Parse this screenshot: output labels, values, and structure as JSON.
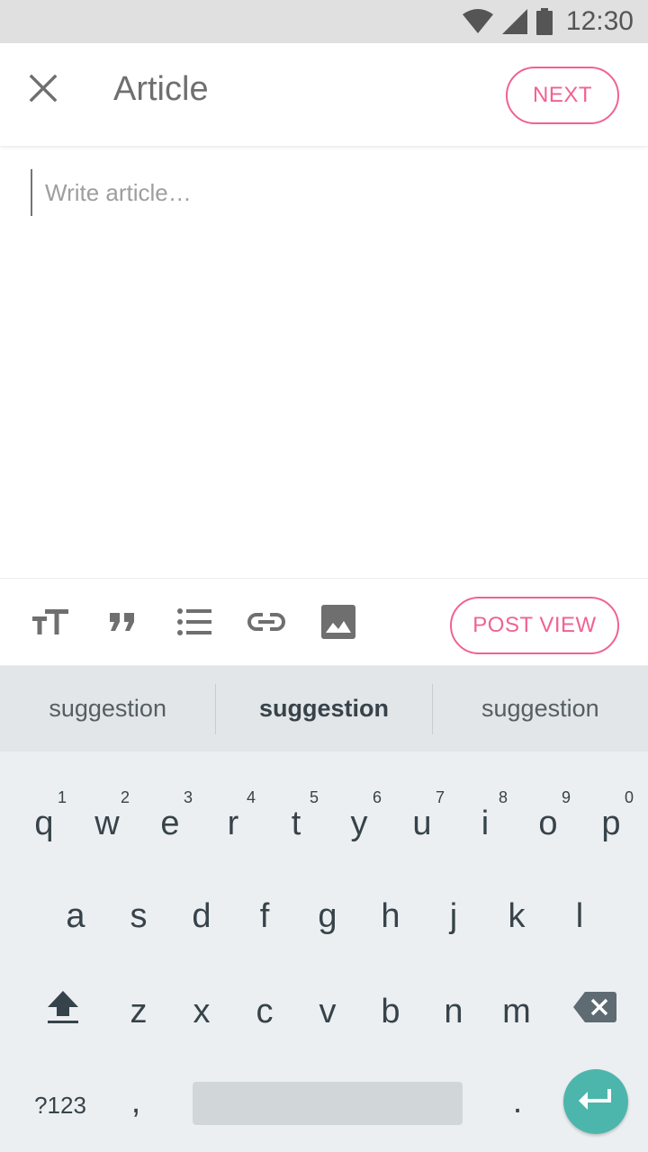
{
  "status_bar": {
    "time": "12:30",
    "icons": [
      "wifi-icon",
      "cell-signal-icon",
      "battery-icon"
    ]
  },
  "app_bar": {
    "close_icon": "close-icon",
    "title": "Article",
    "next_label": "NEXT"
  },
  "editor": {
    "placeholder": "Write article…",
    "value": ""
  },
  "format_toolbar": {
    "tools": [
      "text-size-icon",
      "quote-icon",
      "list-icon",
      "link-icon",
      "image-icon"
    ],
    "post_view_label": "POST VIEW"
  },
  "keyboard": {
    "suggestions": [
      "suggestion",
      "suggestion",
      "suggestion"
    ],
    "row1": [
      {
        "key": "q",
        "hint": "1"
      },
      {
        "key": "w",
        "hint": "2"
      },
      {
        "key": "e",
        "hint": "3"
      },
      {
        "key": "r",
        "hint": "4"
      },
      {
        "key": "t",
        "hint": "5"
      },
      {
        "key": "y",
        "hint": "6"
      },
      {
        "key": "u",
        "hint": "7"
      },
      {
        "key": "i",
        "hint": "8"
      },
      {
        "key": "o",
        "hint": "9"
      },
      {
        "key": "p",
        "hint": "0"
      }
    ],
    "row2": [
      "a",
      "s",
      "d",
      "f",
      "g",
      "h",
      "j",
      "k",
      "l"
    ],
    "row3": [
      "z",
      "x",
      "c",
      "v",
      "b",
      "n",
      "m"
    ],
    "symbols_label": "?123",
    "comma_label": ",",
    "period_label": ".",
    "shift_icon": "shift-icon",
    "backspace_icon": "backspace-icon",
    "enter_icon": "enter-icon"
  },
  "colors": {
    "accent": "#f06292",
    "enter_key": "#4db6ac",
    "status_bar": "#e0e0e0",
    "keyboard_bg": "#eceff1"
  }
}
